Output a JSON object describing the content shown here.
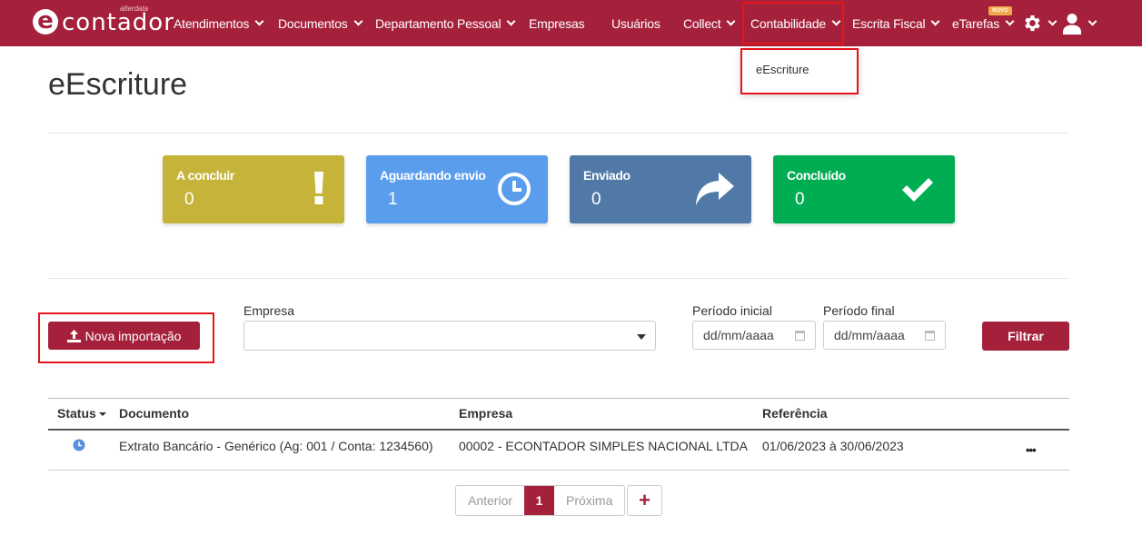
{
  "brand": {
    "name": "contador",
    "subbrand": "alterdata",
    "logo_letter": "e"
  },
  "nav": {
    "items": [
      {
        "label": "Atendimentos"
      },
      {
        "label": "Documentos"
      },
      {
        "label": "Departamento Pessoal"
      },
      {
        "label": "Empresas"
      },
      {
        "label": "Usuários"
      },
      {
        "label": "Collect"
      },
      {
        "label": "Contabilidade"
      },
      {
        "label": "Escrita Fiscal"
      },
      {
        "label": "eTarefas"
      }
    ],
    "new_badge": "NOVO",
    "settings_icon": "gear-icon",
    "user_icon": "user-icon"
  },
  "dropdown": {
    "item": "eEscriture"
  },
  "page": {
    "title": "eEscriture"
  },
  "cards": [
    {
      "title": "A concluir",
      "count": "0",
      "icon": "exclamation-icon",
      "color": "#c6b43a"
    },
    {
      "title": "Aguardando envio",
      "count": "1",
      "icon": "clock-icon",
      "color": "#5a9ded"
    },
    {
      "title": "Enviado",
      "count": "0",
      "icon": "share-arrow-icon",
      "color": "#5079a8"
    },
    {
      "title": "Concluído",
      "count": "0",
      "icon": "check-icon",
      "color": "#00ad52"
    }
  ],
  "filters": {
    "import_label": "Nova importação",
    "empresa_label": "Empresa",
    "empresa_value": "",
    "periodo_inicial_label": "Período inicial",
    "periodo_inicial_placeholder": "dd/mm/aaaa",
    "periodo_final_label": "Período final",
    "periodo_final_placeholder": "dd/mm/aaaa",
    "filter_label": "Filtrar"
  },
  "table": {
    "columns": [
      "Status",
      "Documento",
      "Empresa",
      "Referência"
    ],
    "rows": [
      {
        "status_icon": "clock-icon",
        "documento": "Extrato Bancário - Genérico (Ag: 001 / Conta: 1234560)",
        "empresa": "00002 - ECONTADOR SIMPLES NACIONAL LTDA",
        "referencia": "01/06/2023 à 30/06/2023",
        "actions": "•••"
      }
    ]
  },
  "pagination": {
    "previous": "Anterior",
    "current": "1",
    "next": "Próxima",
    "add": "+"
  },
  "colors": {
    "brand": "#a5213b",
    "highlight": "#e8141c"
  }
}
